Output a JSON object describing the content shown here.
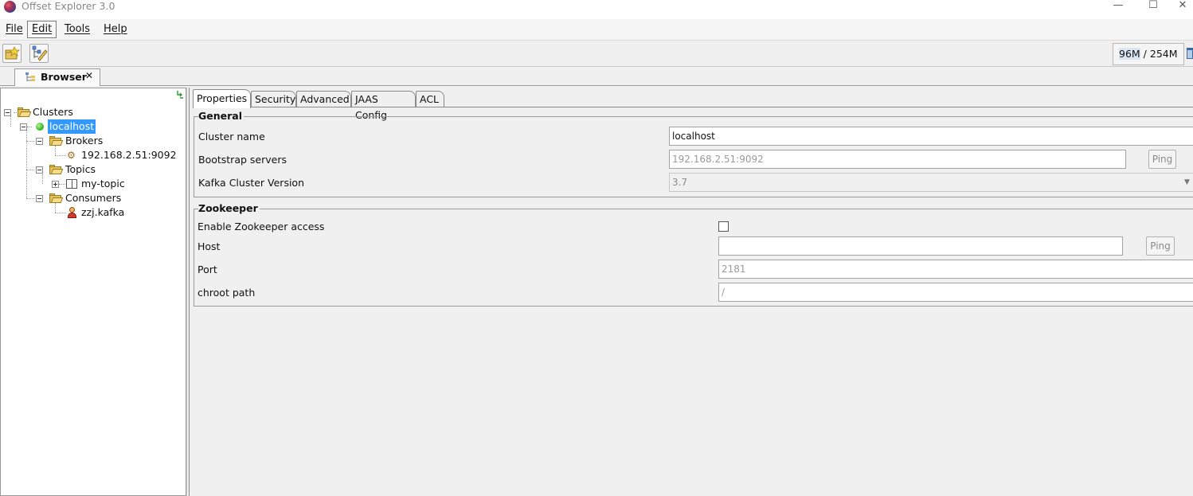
{
  "window": {
    "title": "Offset Explorer  3.0",
    "minimize": "—",
    "maximize": "☐",
    "close": "✕"
  },
  "menu": [
    {
      "label": "File",
      "mnemonic_index": 0
    },
    {
      "label": "Edit",
      "mnemonic_index": 0
    },
    {
      "label": "Tools",
      "mnemonic_index": 0
    },
    {
      "label": "Help",
      "mnemonic_index": 0
    }
  ],
  "toolbar": {
    "memory_used": "96M",
    "memory_sep": " / ",
    "memory_total": "254M"
  },
  "view_tab": {
    "label": "Browser",
    "close": "✕"
  },
  "tree": {
    "root": "Clusters",
    "cluster": "localhost",
    "brokers_label": "Brokers",
    "broker": "192.168.2.51:9092",
    "topics_label": "Topics",
    "topic": "my-topic",
    "consumers_label": "Consumers",
    "consumer": "zzj.kafka"
  },
  "tabs": [
    "Properties",
    "Security",
    "Advanced",
    "JAAS Config",
    "ACL"
  ],
  "general": {
    "title": "General",
    "cluster_name_label": "Cluster name",
    "cluster_name_value": "localhost",
    "bootstrap_label": "Bootstrap servers",
    "bootstrap_placeholder": "192.168.2.51:9092",
    "ping_label": "Ping",
    "version_label": "Kafka Cluster Version",
    "version_value": "3.7"
  },
  "zookeeper": {
    "title": "Zookeeper",
    "enable_label": "Enable Zookeeper access",
    "enable_checked": false,
    "host_label": "Host",
    "host_value": "",
    "ping_label": "Ping",
    "port_label": "Port",
    "port_placeholder": "2181",
    "chroot_label": "chroot path",
    "chroot_placeholder": "/"
  },
  "colors": {
    "selection": "#3399ff",
    "folder": "#e7c45d",
    "status_ok": "#3cbb2a"
  }
}
